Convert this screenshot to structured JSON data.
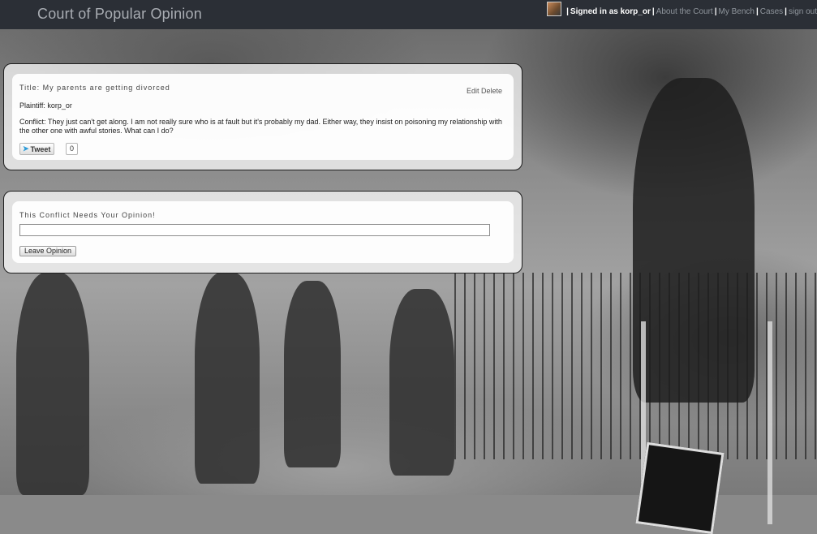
{
  "header": {
    "brand": "Court of Popular Opinion",
    "signed_in": "Signed in as korp_or",
    "nav": [
      "About the Court",
      "My Bench",
      "Cases",
      "sign out"
    ]
  },
  "case": {
    "title": "Title: My parents are getting divorced",
    "edit_label": "Edit",
    "delete_label": "Delete",
    "plaintiff": "Plaintiff: korp_or",
    "conflict": "Conflict: They just can't get along. I am not really sure who is at fault but it's probably my dad. Either way, they insist on poisoning my relationship with the other one with awful stories. What can I do?",
    "tweet_label": "Tweet",
    "tweet_count": "0"
  },
  "opinion": {
    "heading": "This Conflict Needs Your Opinion!",
    "input_value": "",
    "button_label": "Leave Opinion"
  },
  "colors": {
    "topbar": "#2b2f36",
    "brand_text": "#a9adb3",
    "tweet_bird": "#2a9ad8"
  },
  "icons": [
    "avatar",
    "twitter-bird-icon"
  ]
}
